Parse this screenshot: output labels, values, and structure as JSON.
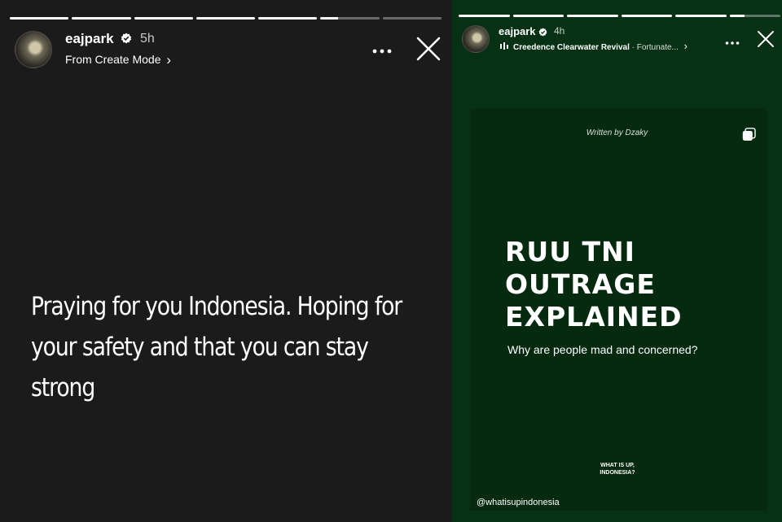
{
  "left_story": {
    "progress_fill": [
      1,
      1,
      1,
      1,
      1,
      0.3,
      0
    ],
    "username": "eajpark",
    "time_ago": "5h",
    "subline": "From Create Mode",
    "subline_chevron": "›",
    "text": "Praying for you Indonesia. Hoping for your safety and that you can stay strong",
    "icons": [
      "verified-badge-icon",
      "more-options-icon",
      "close-icon",
      "chevron-right-icon"
    ]
  },
  "right_story": {
    "progress_fill": [
      1,
      1,
      1,
      1,
      1,
      0.3
    ],
    "username": "eajpark",
    "time_ago": "4h",
    "music_artist": "Creedence Clearwater Revival",
    "music_separator": " · ",
    "music_title": "Fortunate...",
    "music_chevron": "›",
    "written_by": "Written by Dzaky",
    "headline": [
      "RUU TNI",
      "OUTRAGE",
      "EXPLAINED"
    ],
    "subheadline": "Why are people mad and concerned?",
    "brand_line1": "WHAT IS UP,",
    "brand_line2": "INDONESIA?",
    "handle": "@whatisupindonesia",
    "icons": [
      "verified-badge-icon",
      "music-bars-icon",
      "more-options-icon",
      "close-icon",
      "multi-page-icon"
    ]
  },
  "colors": {
    "left_bg": "#1b1b1b",
    "right_bg": "#073114",
    "card_bg": "#052a10",
    "verified_blue": "#ffffff"
  }
}
